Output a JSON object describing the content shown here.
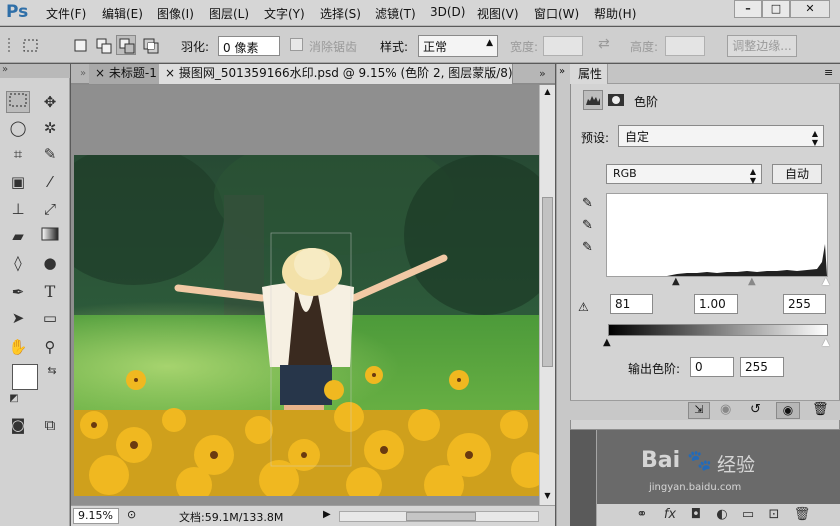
{
  "app": {
    "logo": "Ps"
  },
  "menu": [
    "文件(F)",
    "编辑(E)",
    "图像(I)",
    "图层(L)",
    "文字(Y)",
    "选择(S)",
    "滤镜(T)",
    "3D(D)",
    "视图(V)",
    "窗口(W)",
    "帮助(H)"
  ],
  "window_controls": {
    "minimize": "–",
    "restore": "□",
    "close": "✕"
  },
  "options": {
    "feather_label": "羽化:",
    "feather_value": "0 像素",
    "antialias_label": "消除锯齿",
    "style_label": "样式:",
    "style_value": "正常",
    "width_label": "宽度:",
    "swap_glyph": "⇄",
    "height_label": "高度:",
    "refine_edge_label": "调整边缘..."
  },
  "document": {
    "tabs": [
      {
        "label": "未标题-1",
        "close": "×"
      },
      {
        "label": "摄图网_501359166水印.psd @ 9.15% (色阶 2, 图层蒙版/8)",
        "close": "×"
      }
    ],
    "collapse_glyph": "«",
    "expand_glyph": "»"
  },
  "status": {
    "zoom": "9.15%",
    "doc_info": "文档:59.1M/133.8M"
  },
  "properties": {
    "panel_title": "属性",
    "adjustment_name": "色阶",
    "preset_label": "预设:",
    "preset_value": "自定",
    "channel_value": "RGB",
    "auto_label": "自动",
    "input_black": "81",
    "input_gamma": "1.00",
    "input_white": "255",
    "output_label": "输出色阶:",
    "output_black": "0",
    "output_white": "255"
  },
  "watermark": {
    "brand": "Bai",
    "paw": "🐾",
    "suffix": "经验",
    "url": "jingyan.baidu.com"
  }
}
